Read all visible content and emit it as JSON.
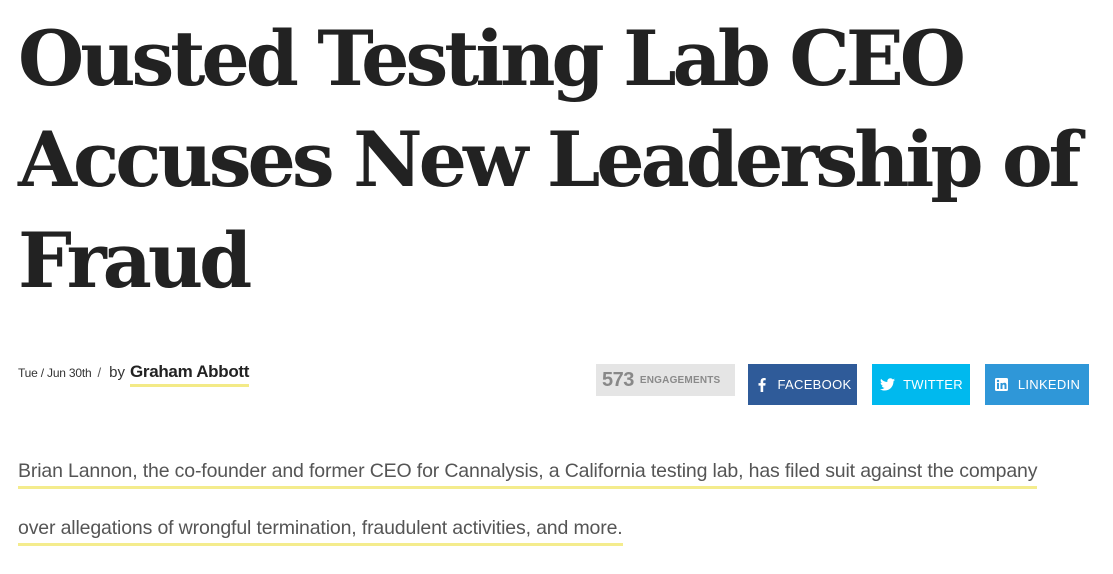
{
  "article": {
    "headline": "Ousted Testing Lab CEO Accuses New Leadership of Fraud",
    "date": "Tue / Jun 30th",
    "separator": "/",
    "by_label": "by",
    "author": "Graham Abbott",
    "lede_line_1": "Brian Lannon, the co-founder and former CEO for Cannalysis, a California testing lab, has filed suit against the company",
    "lede_line_2": "over allegations of wrongful termination, fraudulent activities, and more."
  },
  "share": {
    "engagement_count": "573",
    "engagement_label": "ENGAGEMENTS",
    "facebook_label": "FACEBOOK",
    "twitter_label": "TWITTER",
    "linkedin_label": "LINKEDIN",
    "facebook_icon": "facebook-icon",
    "twitter_icon": "twitter-icon",
    "linkedin_icon": "linkedin-icon"
  },
  "colors": {
    "facebook": "#2f5b99",
    "twitter": "#00b9ee",
    "linkedin": "#2f97d8",
    "highlight_underline": "#f3ea87",
    "engagement_bg": "#e5e5e5"
  }
}
